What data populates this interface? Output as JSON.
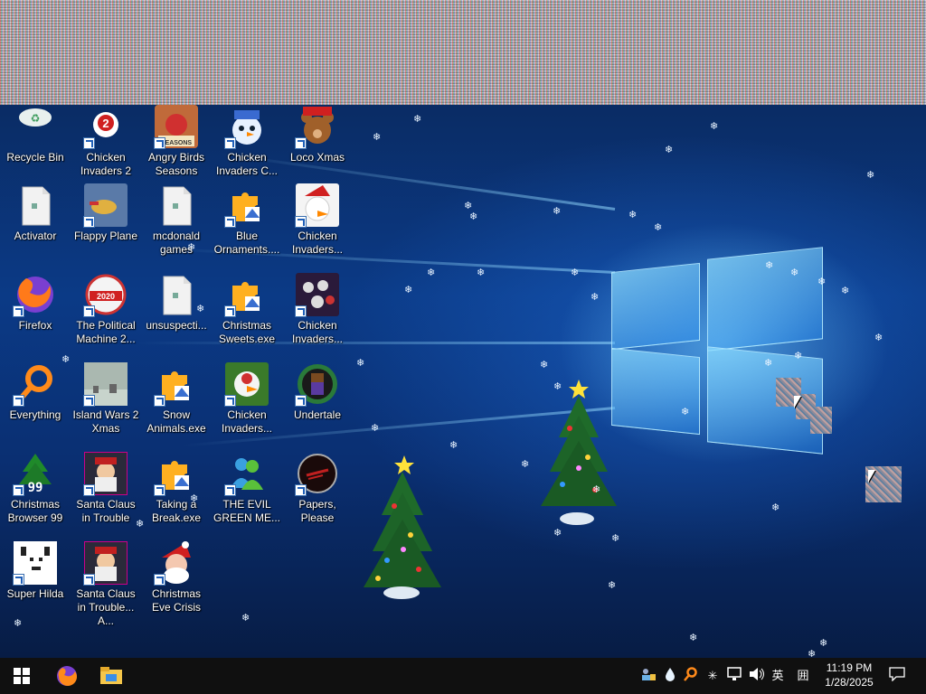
{
  "desktop": {
    "icons": [
      {
        "label": "Recycle Bin",
        "icon": "recycle-bin-icon",
        "shortcut": false
      },
      {
        "label": "Chicken Invaders 2",
        "icon": "chicken-icon",
        "shortcut": true
      },
      {
        "label": "Angry Birds Seasons",
        "icon": "angry-birds-icon",
        "shortcut": true
      },
      {
        "label": "Chicken Invaders C...",
        "icon": "chicken-snowman-icon",
        "shortcut": true
      },
      {
        "label": "Loco Xmas",
        "icon": "teddy-bear-icon",
        "shortcut": true
      },
      {
        "label": "Activator",
        "icon": "file-icon",
        "shortcut": false
      },
      {
        "label": "Flappy Plane",
        "icon": "plane-icon",
        "shortcut": true
      },
      {
        "label": "mcdonald games",
        "icon": "file-icon",
        "shortcut": false
      },
      {
        "label": "Blue Ornaments....",
        "icon": "puzzle-icon",
        "shortcut": true
      },
      {
        "label": "Chicken Invaders...",
        "icon": "chicken-santa-icon",
        "shortcut": true
      },
      {
        "label": "Firefox",
        "icon": "firefox-icon",
        "shortcut": true
      },
      {
        "label": "The Political Machine 2...",
        "icon": "political-machine-icon",
        "shortcut": true
      },
      {
        "label": "unsuspecti...",
        "icon": "file-icon",
        "shortcut": false
      },
      {
        "label": "Christmas Sweets.exe",
        "icon": "puzzle-icon",
        "shortcut": true
      },
      {
        "label": "Chicken Invaders...",
        "icon": "chicken-space-icon",
        "shortcut": true
      },
      {
        "label": "Everything",
        "icon": "search-icon",
        "shortcut": true
      },
      {
        "label": "Island Wars 2 Xmas",
        "icon": "island-icon",
        "shortcut": true
      },
      {
        "label": "Snow Animals.exe",
        "icon": "puzzle-icon",
        "shortcut": true
      },
      {
        "label": "Chicken Invaders...",
        "icon": "chicken-green-icon",
        "shortcut": true
      },
      {
        "label": "Undertale",
        "icon": "undertale-icon",
        "shortcut": true
      },
      {
        "label": "Christmas Browser 99",
        "icon": "tree-icon",
        "shortcut": true
      },
      {
        "label": "Santa Claus in Trouble",
        "icon": "santa-icon",
        "shortcut": true
      },
      {
        "label": "Taking a Break.exe",
        "icon": "puzzle-icon",
        "shortcut": true
      },
      {
        "label": "THE EVIL GREEN ME...",
        "icon": "msn-icon",
        "shortcut": true
      },
      {
        "label": "Papers, Please",
        "icon": "papers-please-icon",
        "shortcut": true
      },
      {
        "label": "Super Hilda",
        "icon": "pixel-dog-icon",
        "shortcut": true
      },
      {
        "label": "Santa Claus in Trouble... A...",
        "icon": "santa-icon",
        "shortcut": true
      },
      {
        "label": "Christmas Eve Crisis",
        "icon": "santa-face-icon",
        "shortcut": true
      }
    ],
    "tree_badge": "99",
    "political_badge": "2020",
    "chicken2_badge": "2",
    "angry_badge": "SEASONS"
  },
  "taskbar": {
    "start": "windows-logo-icon",
    "pinned": [
      "firefox-icon",
      "file-explorer-icon"
    ],
    "tray": {
      "ime_mode": "英",
      "ime_grid": "囲",
      "time": "11:19 PM",
      "date": "1/28/2025"
    }
  }
}
